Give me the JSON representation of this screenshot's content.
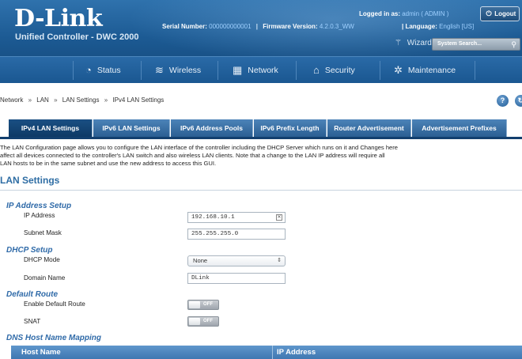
{
  "header": {
    "brand": "D-Link",
    "product": "Unified Controller - DWC 2000",
    "serial_label": "Serial Number:",
    "serial_value": "000000000001",
    "firmware_label": "Firmware Version:",
    "firmware_value": "4.2.0.3_WW",
    "logged_label": "Logged in as:",
    "logged_value": "admin ( ADMIN )",
    "logout_label": "Logout",
    "language_label": "Language:",
    "language_value": "English [US]",
    "wizard_label": "Wizard",
    "search_placeholder": "System Search...",
    "colors": {
      "header_bg": "#1c5a93",
      "accent_text": "#9fd0ff"
    }
  },
  "nav": {
    "items": [
      {
        "label": "Status",
        "icon": "dashboard-icon"
      },
      {
        "label": "Wireless",
        "icon": "wifi-icon"
      },
      {
        "label": "Network",
        "icon": "network-icon"
      },
      {
        "label": "Security",
        "icon": "lock-icon"
      },
      {
        "label": "Maintenance",
        "icon": "gears-icon"
      }
    ]
  },
  "breadcrumb": [
    "Network",
    "LAN",
    "LAN Settings",
    "IPv4 LAN Settings"
  ],
  "tabs": [
    {
      "label": "IPv4 LAN Settings",
      "active": true
    },
    {
      "label": "IPv6 LAN Settings",
      "active": false
    },
    {
      "label": "IPv6 Address Pools",
      "active": false
    },
    {
      "label": "IPv6 Prefix Length",
      "active": false
    },
    {
      "label": "Router Advertisement",
      "active": false
    },
    {
      "label": "Advertisement Prefixes",
      "active": false
    }
  ],
  "description": {
    "line1": "The LAN Configuration page allows you to configure the LAN interface of the controller including the DHCP Server which runs on it and Changes here",
    "line2": "affect all devices connected to the controller's LAN switch and also wireless LAN clients. Note that a change to the LAN IP address will require all",
    "line3": "LAN hosts to be in the same subnet and use the new address to access this GUI."
  },
  "section_title": "LAN Settings",
  "form": {
    "ip_setup": {
      "title": "IP Address Setup",
      "ip_label": "IP Address",
      "ip_value": "192.168.10.1",
      "mask_label": "Subnet Mask",
      "mask_value": "255.255.255.0"
    },
    "dhcp": {
      "title": "DHCP Setup",
      "mode_label": "DHCP Mode",
      "mode_value": "None",
      "domain_label": "Domain Name",
      "domain_value": "DLink"
    },
    "default_route": {
      "title": "Default Route",
      "enable_label": "Enable Default Route",
      "enable_state": "OFF",
      "snat_label": "SNAT",
      "snat_state": "OFF"
    },
    "dns_mapping": {
      "title": "DNS Host Name Mapping",
      "columns": [
        "Host Name",
        "IP Address"
      ]
    }
  }
}
